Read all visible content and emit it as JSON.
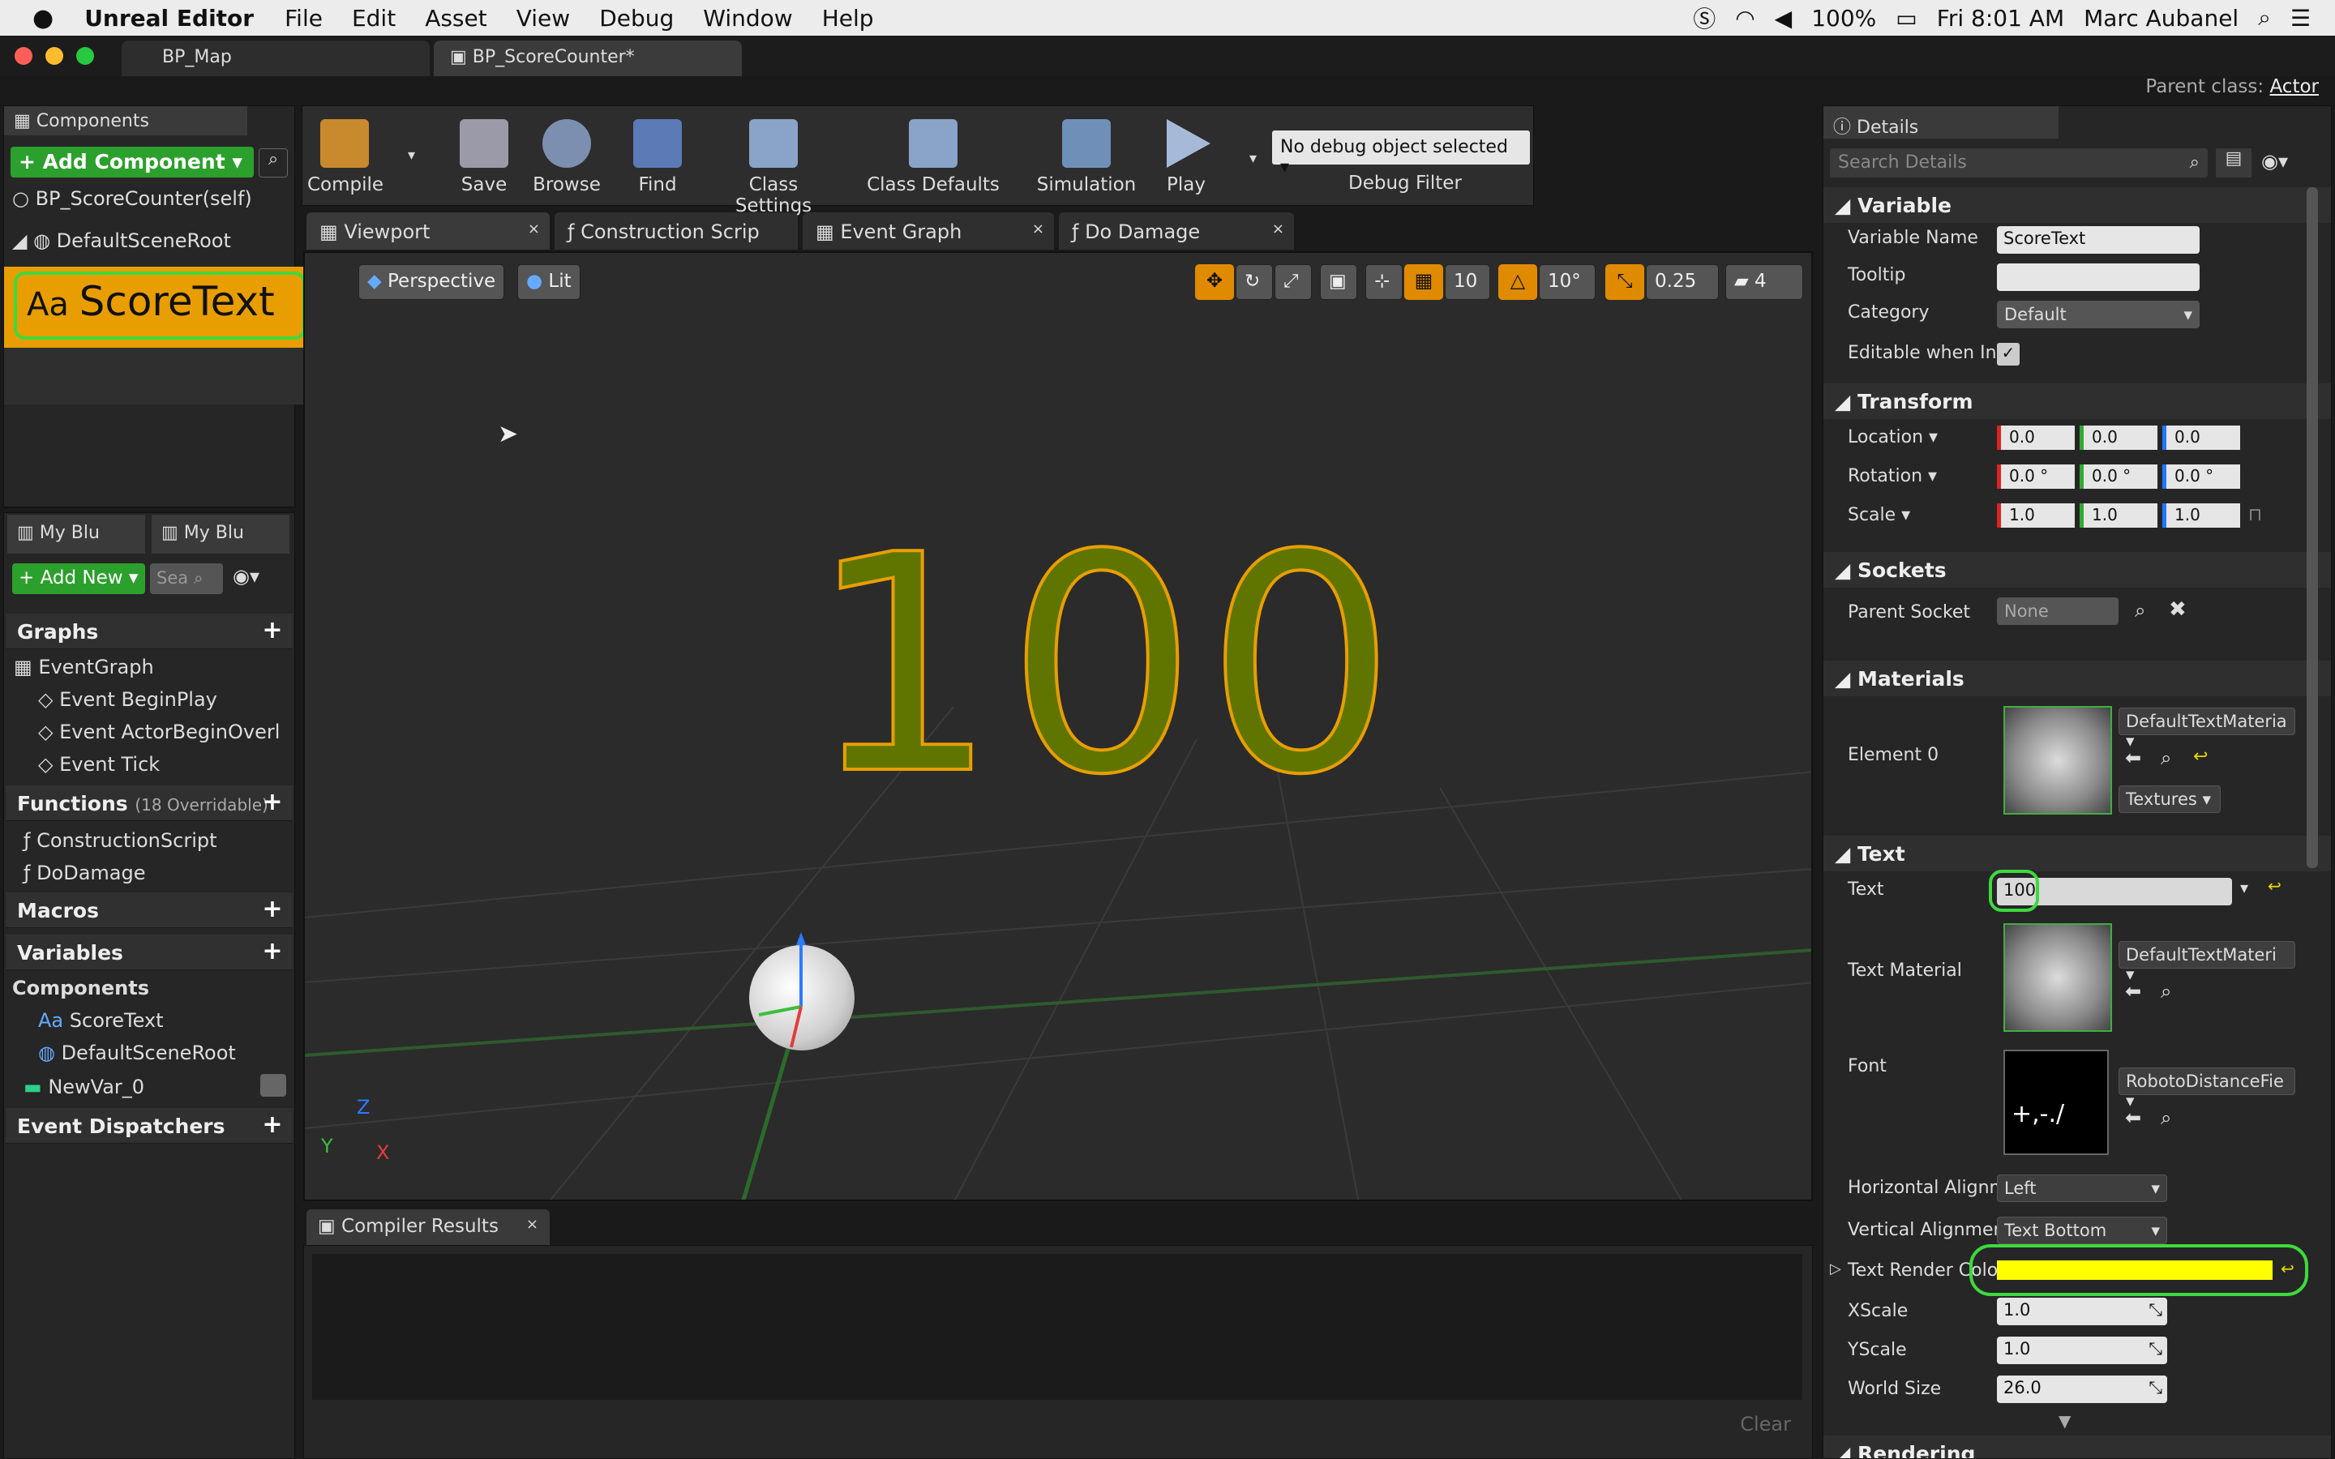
{
  "menubar": {
    "app": "Unreal Editor",
    "menus": [
      "File",
      "Edit",
      "Asset",
      "View",
      "Debug",
      "Window",
      "Help"
    ],
    "battery": "100%",
    "clock": "Fri 8:01 AM",
    "user": "Marc Aubanel"
  },
  "tabs": {
    "map": "BP_Map",
    "counter": "BP_ScoreCounter*"
  },
  "parent_class": {
    "label": "Parent class:",
    "value": "Actor"
  },
  "components": {
    "title": "Components",
    "add_button": "+ Add Component ▾",
    "self_item": "BP_ScoreCounter(self)",
    "root_item": "DefaultSceneRoot",
    "selected_item": "ScoreText"
  },
  "toolbar": {
    "compile": "Compile",
    "save": "Save",
    "browse": "Browse",
    "find": "Find",
    "class_settings": "Class Settings",
    "class_defaults": "Class Defaults",
    "simulation": "Simulation",
    "play": "Play",
    "debug_select": "No debug object selected",
    "debug_filter": "Debug Filter"
  },
  "editor_tabs": [
    "Viewport",
    "Construction Scrip",
    "Event Graph",
    "Do Damage"
  ],
  "viewport": {
    "perspective": "Perspective",
    "lit": "Lit",
    "grid": "10",
    "angle": "10°",
    "scale": "0.25",
    "cam_speed": "4",
    "score_display": "100",
    "axis_z": "Z",
    "axis_y": "Y",
    "axis_x": "X"
  },
  "my_blueprint": {
    "tab1": "My Blu",
    "tab2": "My Blu",
    "add_new": "+ Add New ▾",
    "search_placeholder": "Sea",
    "graphs_header": "Graphs",
    "graph_items": [
      "EventGraph",
      "Event BeginPlay",
      "Event ActorBeginOverl",
      "Event Tick"
    ],
    "functions_header": "Functions",
    "functions_hint": "(18 Overridable)",
    "function_items": [
      "ConstructionScript",
      "DoDamage"
    ],
    "macros_header": "Macros",
    "variables_header": "Variables",
    "components_header": "Components",
    "component_items": [
      "ScoreText",
      "DefaultSceneRoot"
    ],
    "newvar": "NewVar_0",
    "dispatchers_header": "Event Dispatchers"
  },
  "compiler": {
    "title": "Compiler Results",
    "clear": "Clear"
  },
  "details": {
    "title": "Details",
    "search_placeholder": "Search Details",
    "variable": {
      "header": "Variable",
      "name_label": "Variable Name",
      "name_value": "ScoreText",
      "tooltip_label": "Tooltip",
      "tooltip_value": "",
      "category_label": "Category",
      "category_value": "Default",
      "editable_label": "Editable when Inh"
    },
    "transform": {
      "header": "Transform",
      "location_label": "Location ▾",
      "rotation_label": "Rotation ▾",
      "scale_label": "Scale ▾",
      "location": [
        "0.0",
        "0.0",
        "0.0"
      ],
      "rotation": [
        "0.0 °",
        "0.0 °",
        "0.0 °"
      ],
      "scale": [
        "1.0",
        "1.0",
        "1.0"
      ]
    },
    "sockets": {
      "header": "Sockets",
      "parent_label": "Parent Socket",
      "parent_value": "None"
    },
    "materials": {
      "header": "Materials",
      "element_label": "Element 0",
      "material_value": "DefaultTextMateria",
      "textures": "Textures"
    },
    "text": {
      "header": "Text",
      "text_label": "Text",
      "text_value": "100",
      "material_label": "Text Material",
      "material_value": "DefaultTextMateri",
      "font_label": "Font",
      "font_value": "RobotoDistanceFie",
      "halign_label": "Horizontal Alignm",
      "halign_value": "Left",
      "valign_label": "Vertical Alignmer",
      "valign_value": "Text Bottom",
      "color_label": "Text Render Colo",
      "color_hex": "#ffff00",
      "xscale_label": "XScale",
      "xscale_value": "1.0",
      "yscale_label": "YScale",
      "yscale_value": "1.0",
      "worldsize_label": "World Size",
      "worldsize_value": "26.0"
    },
    "rendering_header": "Rendering"
  }
}
